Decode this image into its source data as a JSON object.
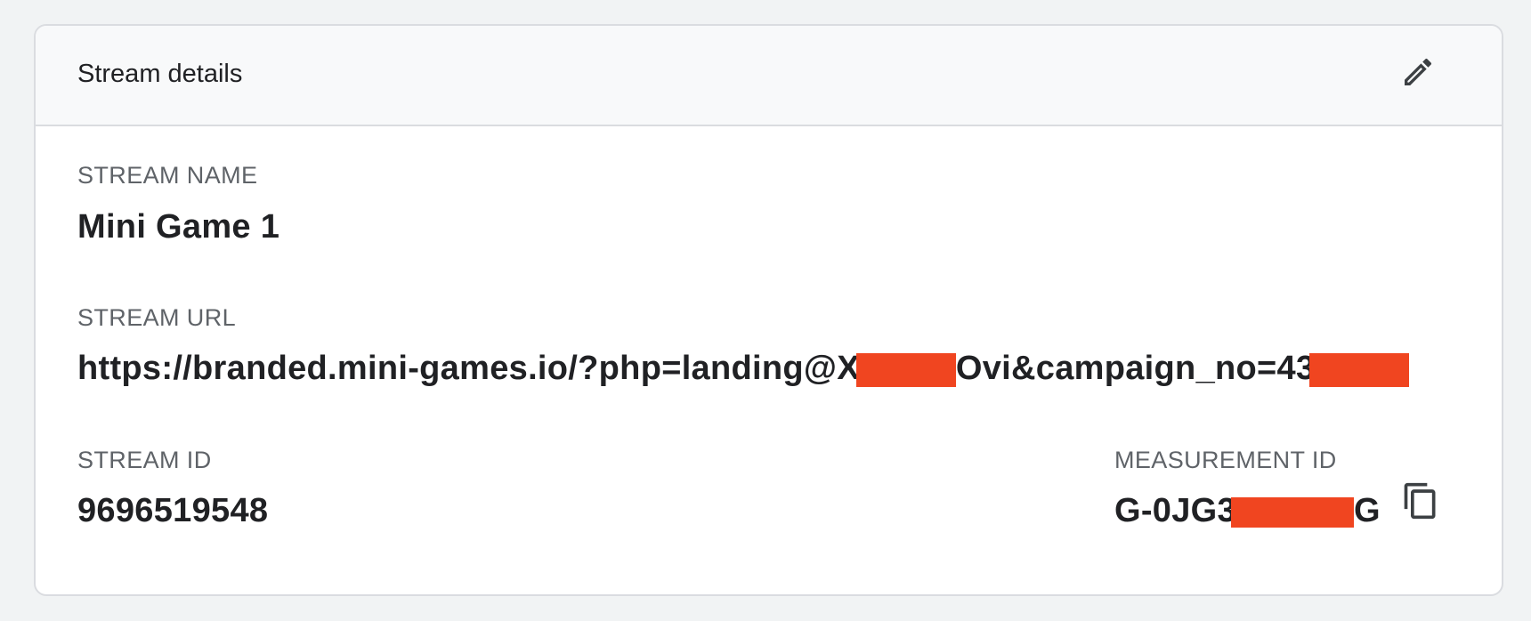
{
  "card": {
    "title": "Stream details",
    "edit_icon": "pencil-icon"
  },
  "stream_name": {
    "label": "STREAM NAME",
    "value": "Mini Game 1"
  },
  "stream_url": {
    "label": "STREAM URL",
    "value_part1": "https://branded.mini-games.io/?php=landing@X",
    "value_part2": "Ovi&campaign_no=43"
  },
  "stream_id": {
    "label": "STREAM ID",
    "value": "9696519548"
  },
  "measurement_id": {
    "label": "MEASUREMENT ID",
    "value_prefix": "G-0JG3",
    "value_suffix": "G",
    "copy_icon": "copy-icon"
  },
  "colors": {
    "redaction": "#f04520",
    "label_gray": "#5f6368",
    "text_dark": "#202124",
    "header_bg": "#f8f9fa",
    "border": "#dadce0"
  }
}
